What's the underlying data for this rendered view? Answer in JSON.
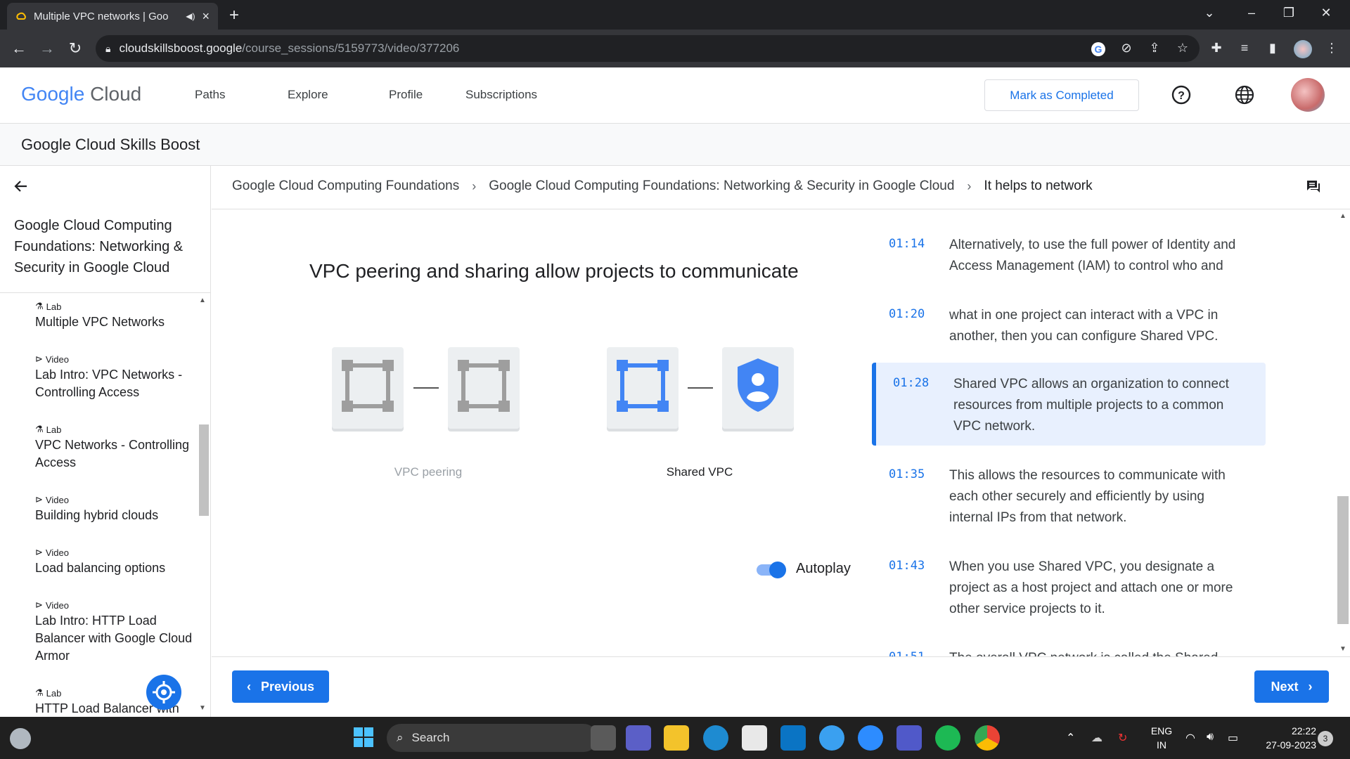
{
  "browser": {
    "tab_title": "Multiple VPC networks | Goo",
    "url_host": "cloudskillsboost.google",
    "url_path": "/course_sessions/5159773/video/377206"
  },
  "header": {
    "logo_google": "Google",
    "logo_cloud": "Cloud",
    "nav": [
      "Paths",
      "Explore",
      "Profile",
      "Subscriptions"
    ],
    "mark_completed": "Mark as Completed"
  },
  "subheader": {
    "title": "Google Cloud Skills Boost"
  },
  "sidebar": {
    "course_title": "Google Cloud Computing Foundations: Networking & Security in Google Cloud",
    "items": [
      {
        "kind": "Lab",
        "name": "Multiple VPC Networks"
      },
      {
        "kind": "Video",
        "name": "Lab Intro: VPC Networks - Controlling Access"
      },
      {
        "kind": "Lab",
        "name": "VPC Networks - Controlling Access"
      },
      {
        "kind": "Video",
        "name": "Building hybrid clouds"
      },
      {
        "kind": "Video",
        "name": "Load balancing options"
      },
      {
        "kind": "Video",
        "name": "Lab Intro: HTTP Load Balancer with Google Cloud Armor"
      },
      {
        "kind": "Lab",
        "name": "HTTP Load Balancer with"
      }
    ]
  },
  "breadcrumb": [
    "Google Cloud Computing Foundations",
    "Google Cloud Computing Foundations: Networking & Security in Google Cloud",
    "It helps to network"
  ],
  "slide": {
    "title": "VPC peering and sharing allow projects to communicate",
    "label_peering": "VPC peering",
    "label_shared": "Shared VPC"
  },
  "autoplay": {
    "label": "Autoplay",
    "enabled": true
  },
  "transcript": [
    {
      "time": "01:14",
      "text": "Alternatively, to use the full power of Identity and Access Management (IAM) to control who and",
      "active": false
    },
    {
      "time": "01:20",
      "text": "what in one project can interact with a VPC in another, then you can configure Shared VPC.",
      "active": false
    },
    {
      "time": "01:28",
      "text": "Shared VPC allows an organization to connect resources from multiple projects to a common VPC network.",
      "active": true
    },
    {
      "time": "01:35",
      "text": "This allows the resources to communicate with each other securely and efficiently by using internal IPs from that network.",
      "active": false
    },
    {
      "time": "01:43",
      "text": "When you use Shared VPC, you designate a project as a host project and attach one or more other service projects to it.",
      "active": false
    },
    {
      "time": "01:51",
      "text": "The overall VPC network is called the Shared",
      "active": false
    }
  ],
  "footer": {
    "previous": "Previous",
    "next": "Next"
  },
  "taskbar": {
    "search": "Search",
    "lang1": "ENG",
    "lang2": "IN",
    "time": "22:22",
    "date": "27-09-2023",
    "notifications": "3"
  },
  "colors": {
    "accent": "#1a73e8",
    "active_bg": "#e8f0fe"
  }
}
